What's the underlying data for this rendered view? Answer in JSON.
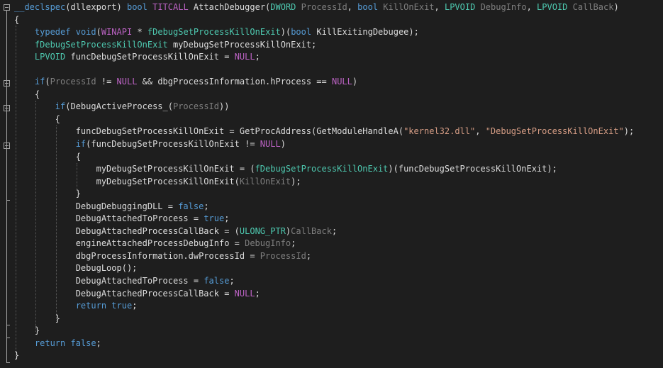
{
  "code": {
    "lines": [
      [
        [
          "k",
          "__declspec"
        ],
        [
          "f",
          "("
        ],
        [
          "f",
          "dllexport"
        ],
        [
          "f",
          ") "
        ],
        [
          "k",
          "bool"
        ],
        [
          "f",
          " "
        ],
        [
          "m",
          "TITCALL"
        ],
        [
          "f",
          " AttachDebugger("
        ],
        [
          "t",
          "DWORD"
        ],
        [
          "f",
          " "
        ],
        [
          "p",
          "ProcessId"
        ],
        [
          "f",
          ", "
        ],
        [
          "k",
          "bool"
        ],
        [
          "f",
          " "
        ],
        [
          "p",
          "KillOnExit"
        ],
        [
          "f",
          ", "
        ],
        [
          "t",
          "LPVOID"
        ],
        [
          "f",
          " "
        ],
        [
          "p",
          "DebugInfo"
        ],
        [
          "f",
          ", "
        ],
        [
          "t",
          "LPVOID"
        ],
        [
          "f",
          " "
        ],
        [
          "p",
          "CallBack"
        ],
        [
          "f",
          ")"
        ]
      ],
      [
        [
          "f",
          "{"
        ]
      ],
      [
        [
          "f",
          "    "
        ],
        [
          "k",
          "typedef"
        ],
        [
          "f",
          " "
        ],
        [
          "k",
          "void"
        ],
        [
          "f",
          "("
        ],
        [
          "m",
          "WINAPI"
        ],
        [
          "f",
          " * "
        ],
        [
          "t",
          "fDebugSetProcessKillOnExit"
        ],
        [
          "f",
          ")("
        ],
        [
          "k",
          "bool"
        ],
        [
          "f",
          " "
        ],
        [
          "f",
          "KillExitingDebugee"
        ],
        [
          "f",
          ");"
        ]
      ],
      [
        [
          "f",
          "    "
        ],
        [
          "t",
          "fDebugSetProcessKillOnExit"
        ],
        [
          "f",
          " myDebugSetProcessKillOnExit;"
        ]
      ],
      [
        [
          "f",
          "    "
        ],
        [
          "t",
          "LPVOID"
        ],
        [
          "f",
          " funcDebugSetProcessKillOnExit = "
        ],
        [
          "m",
          "NULL"
        ],
        [
          "f",
          ";"
        ]
      ],
      [
        [
          "f",
          ""
        ]
      ],
      [
        [
          "f",
          "    "
        ],
        [
          "k",
          "if"
        ],
        [
          "f",
          "("
        ],
        [
          "p",
          "ProcessId"
        ],
        [
          "f",
          " != "
        ],
        [
          "m",
          "NULL"
        ],
        [
          "f",
          " && dbgProcessInformation.hProcess == "
        ],
        [
          "m",
          "NULL"
        ],
        [
          "f",
          ")"
        ]
      ],
      [
        [
          "f",
          "    {"
        ]
      ],
      [
        [
          "f",
          "        "
        ],
        [
          "k",
          "if"
        ],
        [
          "f",
          "(DebugActiveProcess_("
        ],
        [
          "p",
          "ProcessId"
        ],
        [
          "f",
          "))"
        ]
      ],
      [
        [
          "f",
          "        {"
        ]
      ],
      [
        [
          "f",
          "            funcDebugSetProcessKillOnExit = GetProcAddress(GetModuleHandleA("
        ],
        [
          "s",
          "\"kernel32.dll\""
        ],
        [
          "f",
          ", "
        ],
        [
          "s",
          "\"DebugSetProcessKillOnExit\""
        ],
        [
          "f",
          ");"
        ]
      ],
      [
        [
          "f",
          "            "
        ],
        [
          "k",
          "if"
        ],
        [
          "f",
          "(funcDebugSetProcessKillOnExit != "
        ],
        [
          "m",
          "NULL"
        ],
        [
          "f",
          ")"
        ]
      ],
      [
        [
          "f",
          "            {"
        ]
      ],
      [
        [
          "f",
          "                myDebugSetProcessKillOnExit = ("
        ],
        [
          "t",
          "fDebugSetProcessKillOnExit"
        ],
        [
          "f",
          ")(funcDebugSetProcessKillOnExit);"
        ]
      ],
      [
        [
          "f",
          "                myDebugSetProcessKillOnExit("
        ],
        [
          "p",
          "KillOnExit"
        ],
        [
          "f",
          ");"
        ]
      ],
      [
        [
          "f",
          "            }"
        ]
      ],
      [
        [
          "f",
          "            DebugDebuggingDLL = "
        ],
        [
          "k",
          "false"
        ],
        [
          "f",
          ";"
        ]
      ],
      [
        [
          "f",
          "            DebugAttachedToProcess = "
        ],
        [
          "k",
          "true"
        ],
        [
          "f",
          ";"
        ]
      ],
      [
        [
          "f",
          "            DebugAttachedProcessCallBack = ("
        ],
        [
          "t",
          "ULONG_PTR"
        ],
        [
          "f",
          ")"
        ],
        [
          "p",
          "CallBack"
        ],
        [
          "f",
          ";"
        ]
      ],
      [
        [
          "f",
          "            engineAttachedProcessDebugInfo = "
        ],
        [
          "p",
          "DebugInfo"
        ],
        [
          "f",
          ";"
        ]
      ],
      [
        [
          "f",
          "            dbgProcessInformation.dwProcessId = "
        ],
        [
          "p",
          "ProcessId"
        ],
        [
          "f",
          ";"
        ]
      ],
      [
        [
          "f",
          "            DebugLoop();"
        ]
      ],
      [
        [
          "f",
          "            DebugAttachedToProcess = "
        ],
        [
          "k",
          "false"
        ],
        [
          "f",
          ";"
        ]
      ],
      [
        [
          "f",
          "            DebugAttachedProcessCallBack = "
        ],
        [
          "m",
          "NULL"
        ],
        [
          "f",
          ";"
        ]
      ],
      [
        [
          "f",
          "            "
        ],
        [
          "k",
          "return"
        ],
        [
          "f",
          " "
        ],
        [
          "k",
          "true"
        ],
        [
          "f",
          ";"
        ]
      ],
      [
        [
          "f",
          "        }"
        ]
      ],
      [
        [
          "f",
          "    }"
        ]
      ],
      [
        [
          "f",
          "    "
        ],
        [
          "k",
          "return"
        ],
        [
          "f",
          " "
        ],
        [
          "k",
          "false"
        ],
        [
          "f",
          ";"
        ]
      ],
      [
        [
          "f",
          "}"
        ]
      ]
    ]
  },
  "colors": {
    "background": "#1e1e1e",
    "keyword": "#569cd6",
    "type": "#4ec9b0",
    "macro": "#bd63c5",
    "parameter": "#7f7f7f",
    "string": "#d69d85",
    "default": "#dcdcdc"
  },
  "icons": {
    "fold": "collapse-minus-icon"
  }
}
